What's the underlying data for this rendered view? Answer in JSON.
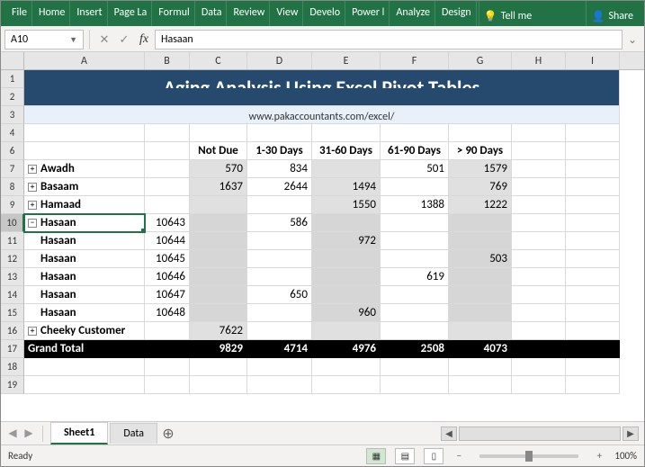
{
  "ribbon": {
    "tabs": [
      "File",
      "Home",
      "Insert",
      "Page La",
      "Formul",
      "Data",
      "Review",
      "View",
      "Develo",
      "Power l",
      "Analyze",
      "Design"
    ],
    "tellme": "Tell me",
    "share": "Share"
  },
  "namebox": "A10",
  "formula": "Hasaan",
  "cols": [
    "A",
    "B",
    "C",
    "D",
    "E",
    "F",
    "G",
    "H",
    "I"
  ],
  "title": "Aging Analysis Using Excel Pivot Tables",
  "subtitle": "www.pakaccountants.com/excel/",
  "headers": {
    "c": "Not Due",
    "d": "1-30 Days",
    "e": "31-60 Days",
    "f": "61-90 Days",
    "g": "> 90 Days"
  },
  "rows": [
    {
      "n": "7",
      "name": "Awadh",
      "tg": "+",
      "c": "570",
      "d": "834",
      "e": "",
      "f": "501",
      "g": "1579"
    },
    {
      "n": "8",
      "name": "Basaam",
      "tg": "+",
      "c": "1637",
      "d": "2644",
      "e": "1494",
      "f": "",
      "g": "769"
    },
    {
      "n": "9",
      "name": "Hamaad",
      "tg": "+",
      "c": "",
      "d": "",
      "e": "1550",
      "f": "1388",
      "g": "1222"
    },
    {
      "n": "10",
      "name": "Hasaan",
      "tg": "−",
      "b": "10643",
      "d": "586",
      "sel": true
    },
    {
      "n": "11",
      "sub": "Hasaan",
      "b": "10644",
      "e": "972"
    },
    {
      "n": "12",
      "sub": "Hasaan",
      "b": "10645",
      "g": "503"
    },
    {
      "n": "13",
      "sub": "Hasaan",
      "b": "10646",
      "f": "619"
    },
    {
      "n": "14",
      "sub": "Hasaan",
      "b": "10647",
      "d": "650"
    },
    {
      "n": "15",
      "sub": "Hasaan",
      "b": "10648",
      "e": "960"
    },
    {
      "n": "16",
      "name": "Cheeky Customer",
      "tg": "+",
      "c": "7622"
    }
  ],
  "grandtotal": {
    "label": "Grand Total",
    "c": "9829",
    "d": "4714",
    "e": "4976",
    "f": "2508",
    "g": "4073"
  },
  "sheets": {
    "active": "Sheet1",
    "other": "Data"
  },
  "status": {
    "ready": "Ready",
    "zoom": "100%"
  }
}
